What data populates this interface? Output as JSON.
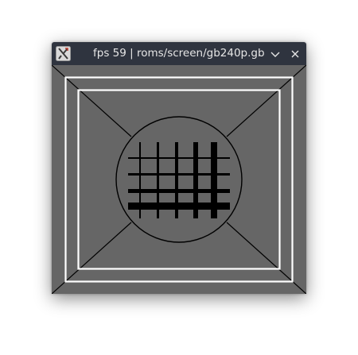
{
  "window": {
    "title": "fps 59 | roms/screen/gb240p.gb",
    "app_icon": "xnes-app-icon",
    "buttons": {
      "menu_icon": "chevron-down-icon",
      "close_icon": "close-icon"
    }
  },
  "screen": {
    "description_colors": {
      "background": "#666666",
      "frame": "#ffffff",
      "lines": "#000000"
    }
  }
}
